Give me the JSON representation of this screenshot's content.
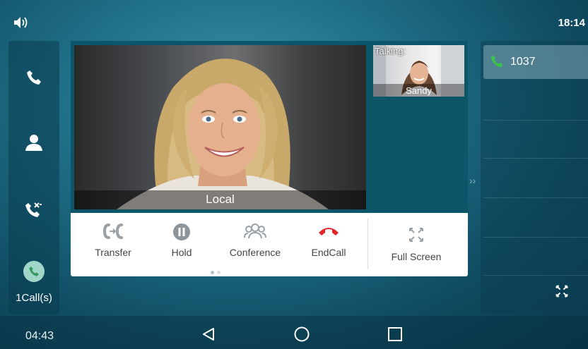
{
  "status": {
    "time": "18:14"
  },
  "left_rail": {
    "items": [
      {
        "icon": "phone-icon"
      },
      {
        "icon": "contact-icon"
      },
      {
        "icon": "call-history-icon"
      }
    ],
    "calls_label": "1Call(s)"
  },
  "video": {
    "local_label": "Local",
    "remote_status": "Talking:",
    "remote_name": "Sandy"
  },
  "controls": [
    {
      "label": "Transfer",
      "icon": "transfer-icon",
      "color": "#9aa1a6"
    },
    {
      "label": "Hold",
      "icon": "hold-icon",
      "color": "#8e959a"
    },
    {
      "label": "Conference",
      "icon": "conference-icon",
      "color": "#9aa1a6"
    },
    {
      "label": "EndCall",
      "icon": "end-call-icon",
      "color": "#e0262b"
    }
  ],
  "fullscreen_label": "Full Screen",
  "right_panel": {
    "line_number": "1037"
  },
  "nav": {
    "time": "04:43"
  },
  "colors": {
    "accent_green": "#3cc24b",
    "end_call_red": "#e0262b"
  }
}
